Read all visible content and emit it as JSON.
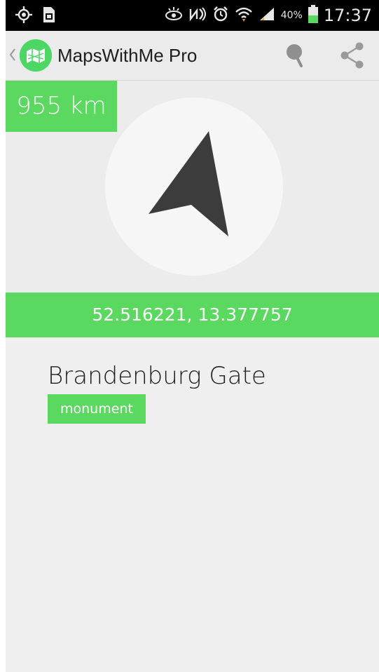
{
  "status_bar": {
    "battery_percent": "40%",
    "time": "17:37",
    "icons": [
      "gps-icon",
      "sim-icon",
      "eye-icon",
      "nfc-icon",
      "alarm-icon",
      "wifi-icon",
      "signal-icon",
      "battery-icon"
    ]
  },
  "action_bar": {
    "title": "MapsWithMe Pro",
    "icons": [
      "back-chevron-icon",
      "app-logo-icon",
      "pin-icon",
      "share-icon"
    ]
  },
  "compass": {
    "distance": "955 km",
    "arrow_icon": "navigation-arrow-icon"
  },
  "location": {
    "coordinates": "52.516221, 13.377757",
    "name": "Brandenburg Gate",
    "type": "monument"
  },
  "colors": {
    "accent_green": "#5ad85f",
    "logo_green": "#4cd764",
    "background": "#efefef",
    "arrow": "#3c3c3c"
  }
}
